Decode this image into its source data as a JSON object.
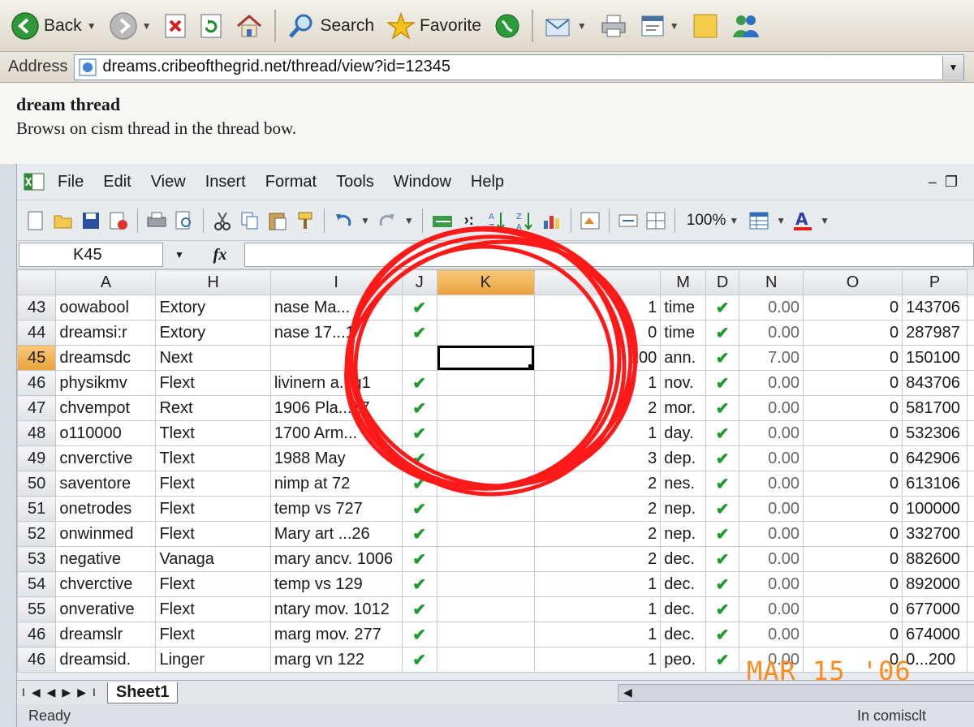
{
  "browser": {
    "toolbar": {
      "back_label": "Back",
      "search_label": "Search",
      "favorite_label": "Favorite"
    },
    "address": {
      "label": "Address",
      "url": "dreams.cribeofthegrid.net/thread/view?id=12345"
    }
  },
  "page": {
    "heading": "dream thread",
    "description": "Browsı on cism thread in the thread bow."
  },
  "excel": {
    "menu": [
      "File",
      "Edit",
      "View",
      "Insert",
      "Format",
      "Tools",
      "Window",
      "Help"
    ],
    "zoom": "100%",
    "name_box": "K45",
    "fx_label": "fx",
    "columns": [
      "A",
      "H",
      "I",
      "J",
      "K",
      "",
      "M",
      "D",
      "N",
      "O",
      "P"
    ],
    "selected_column": "K",
    "selected_row": "45",
    "rows": [
      {
        "n": "43",
        "a": "oowabool",
        "h": "Extory",
        "i": "nase Ma...",
        "j": "✔",
        "m1": "1",
        "m": "time",
        "d": "✔",
        "nv": "0.00",
        "o": "0",
        "p": "143706"
      },
      {
        "n": "44",
        "a": "dreamsi:r",
        "h": "Extory",
        "i": "nase 17...1",
        "j": "✔",
        "m1": "0",
        "m": "time",
        "d": "✔",
        "nv": "0.00",
        "o": "0",
        "p": "287987"
      },
      {
        "n": "45",
        "a": "dreamsdc",
        "h": "Next",
        "i": "",
        "j": "",
        "m1": "100",
        "m": "ann.",
        "d": "✔",
        "nv": "7.00",
        "o": "0",
        "p": "150100"
      },
      {
        "n": "46",
        "a": "physikmv",
        "h": "Flext",
        "i": "livinern a...g1",
        "j": "✔",
        "m1": "1",
        "m": "nov.",
        "d": "✔",
        "nv": "0.00",
        "o": "0",
        "p": "843706"
      },
      {
        "n": "47",
        "a": "chvempot",
        "h": "Rext",
        "i": "1906 Pla...17",
        "j": "✔",
        "m1": "2",
        "m": "mor.",
        "d": "✔",
        "nv": "0.00",
        "o": "0",
        "p": "581700"
      },
      {
        "n": "48",
        "a": "o110000",
        "h": "Tlext",
        "i": "1700 Arm...",
        "j": "✔",
        "m1": "1",
        "m": "day.",
        "d": "✔",
        "nv": "0.00",
        "o": "0",
        "p": "532306"
      },
      {
        "n": "49",
        "a": "cnverctive",
        "h": "Tlext",
        "i": "1988 May",
        "j": "✔",
        "m1": "3",
        "m": "dep.",
        "d": "✔",
        "nv": "0.00",
        "o": "0",
        "p": "642906"
      },
      {
        "n": "50",
        "a": "saventore",
        "h": "Flext",
        "i": "nimp at 72",
        "j": "✔",
        "m1": "2",
        "m": "nes.",
        "d": "✔",
        "nv": "0.00",
        "o": "0",
        "p": "613106"
      },
      {
        "n": "51",
        "a": "onetrodes",
        "h": "Flext",
        "i": "temp vs 727",
        "j": "✔",
        "m1": "2",
        "m": "nep.",
        "d": "✔",
        "nv": "0.00",
        "o": "0",
        "p": "100000"
      },
      {
        "n": "52",
        "a": "onwinmed",
        "h": "Flext",
        "i": "Mary art ...26",
        "j": "✔",
        "m1": "2",
        "m": "nep.",
        "d": "✔",
        "nv": "0.00",
        "o": "0",
        "p": "332700"
      },
      {
        "n": "53",
        "a": "negative",
        "h": "Vanaga",
        "i": "mary ancv. 1006",
        "j": "✔",
        "m1": "2",
        "m": "dec.",
        "d": "✔",
        "nv": "0.00",
        "o": "0",
        "p": "882600"
      },
      {
        "n": "54",
        "a": "chverctive",
        "h": "Flext",
        "i": "temp vs 129",
        "j": "✔",
        "m1": "1",
        "m": "dec.",
        "d": "✔",
        "nv": "0.00",
        "o": "0",
        "p": "892000"
      },
      {
        "n": "55",
        "a": "onverative",
        "h": "Flext",
        "i": "ntary mov. 1012",
        "j": "✔",
        "m1": "1",
        "m": "dec.",
        "d": "✔",
        "nv": "0.00",
        "o": "0",
        "p": "677000"
      },
      {
        "n": "46",
        "a": "dreamslr",
        "h": "Flext",
        "i": "marg mov. 277",
        "j": "✔",
        "m1": "1",
        "m": "dec.",
        "d": "✔",
        "nv": "0.00",
        "o": "0",
        "p": "674000"
      },
      {
        "n": "46",
        "a": "dreamsid.",
        "h": "Linger",
        "i": "marg vn 122",
        "j": "✔",
        "m1": "1",
        "m": "peo.",
        "d": "✔",
        "nv": "0.00",
        "o": "0",
        "p": "0...200"
      }
    ],
    "sheet_tab": "Sheet1",
    "status_left": "Ready",
    "status_right": "In comisclt"
  },
  "date_stamp": "MAR 15 '06",
  "colors": {
    "annotation_circle": "#ff1a1a",
    "selected_header": "#f2b45a",
    "check_green": "#1f9a2c",
    "date_stamp": "#ff8a1c"
  }
}
